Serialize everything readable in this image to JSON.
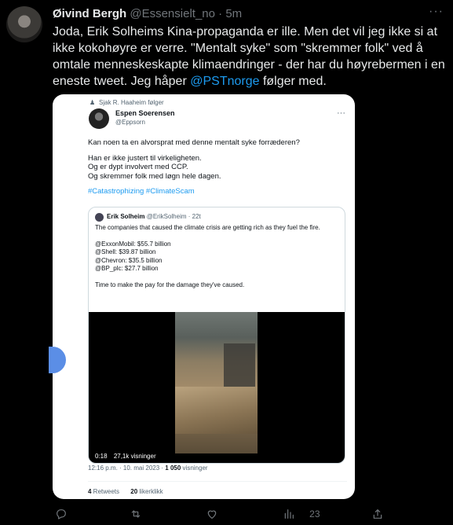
{
  "tweet": {
    "display_name": "Øivind Bergh",
    "handle": "@Essensielt_no",
    "separator": " · ",
    "time": "5m",
    "more": "···",
    "text_1": "Joda, Erik Solheims Kina-propaganda er ille. Men det vil jeg ikke si at ikke kokohøyre er verre. \"Mentalt syke\" som \"skremmer folk\" ved å omtale menneskeskapte klimaendringer - der har du høyrebermen i en eneste tweet. Jeg håper ",
    "mention": "@PSTnorge",
    "text_2": " følger med."
  },
  "screenshot": {
    "followed_by": "Sjak R. Haaheim følger",
    "author_name": "Espen Soerensen",
    "author_handle": "@Eppsorn",
    "more": "···",
    "line_1": "Kan noen ta en alvorsprat med denne mentalt syke forræderen?",
    "line_2": "Han er ikke justert til virkeligheten.",
    "line_3": "Og er dypt involvert med CCP.",
    "line_4": "Og skremmer folk med løgn hele dagen.",
    "hashtags": "#Catastrophizing #ClimateScam",
    "quote": {
      "author_name": "Erik Solheim",
      "author_handle": "@ErikSolheim",
      "time": " · 22t",
      "line_1": "The companies that caused the climate crisis are getting rich as they fuel the fire.",
      "line_2": "@ExxonMobil: $55.7 billion",
      "line_3": "@Shell: $39.87 billion",
      "line_4": "@Chevron: $35.5 billion",
      "line_5": "@BP_plc: $27.7 billion",
      "line_6": "Time to make the pay for the damage they've caused.",
      "video_time": "0:18",
      "video_views": "27,1k visninger"
    },
    "timestamp": "12:16 p.m. · 10. mai 2023 · ",
    "views_count": "1 050",
    "views_label": " visninger",
    "retweets_count": "4",
    "retweets_label": " Retweets",
    "likes_count": "20",
    "likes_label": " likerklikk"
  },
  "actions": {
    "views_count": "23"
  },
  "icons": [
    "reply-icon",
    "retweet-icon",
    "like-icon",
    "views-icon",
    "share-icon"
  ]
}
